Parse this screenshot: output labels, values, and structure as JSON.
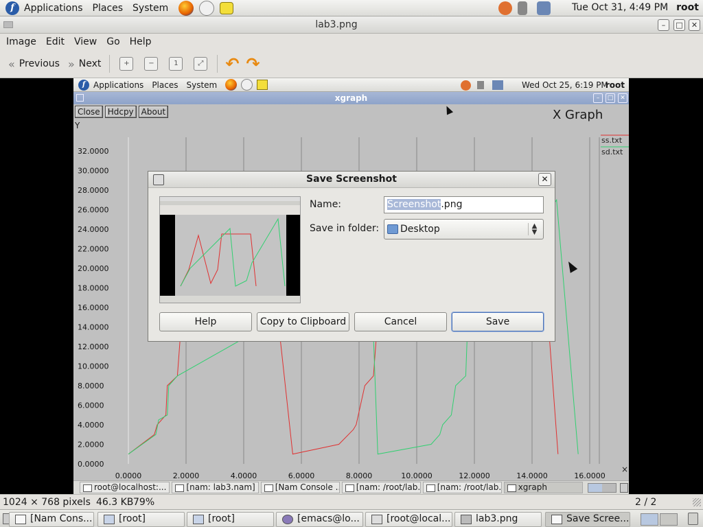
{
  "top_panel": {
    "menus": [
      "Applications",
      "Places",
      "System"
    ],
    "clock": "Tue Oct 31,  4:49 PM",
    "user": "root"
  },
  "window": {
    "title": "lab3.png",
    "menus": [
      "Image",
      "Edit",
      "View",
      "Go",
      "Help"
    ],
    "toolbar": {
      "previous": "Previous",
      "next": "Next"
    }
  },
  "inner": {
    "menus": [
      "Applications",
      "Places",
      "System"
    ],
    "clock": "Wed Oct 25,  6:19 PM",
    "user": "root",
    "xgraph": {
      "title": "xgraph",
      "buttons": [
        "Close",
        "Hdcpy",
        "About"
      ],
      "graph_title": "X Graph",
      "ylabel": "Y",
      "legend": [
        "ss.txt",
        "sd.txt"
      ]
    },
    "taskbar": [
      "root@localhost:...",
      "[nam: lab3.nam]",
      "[Nam Console ...",
      "[nam: /root/lab...",
      "[nam: /root/lab...",
      "xgraph"
    ]
  },
  "chart_data": {
    "type": "line",
    "title": "X Graph",
    "xlabel": "",
    "ylabel": "Y",
    "xlim": [
      0,
      16
    ],
    "ylim": [
      0,
      32
    ],
    "x_ticks": [
      "0.0000",
      "2.0000",
      "4.0000",
      "6.0000",
      "8.0000",
      "10.0000",
      "12.0000",
      "14.0000",
      "16.0000"
    ],
    "y_ticks": [
      "0.0000",
      "2.0000",
      "4.0000",
      "6.0000",
      "8.0000",
      "10.0000",
      "12.0000",
      "14.0000",
      "16.0000",
      "18.0000",
      "20.0000",
      "22.0000",
      "24.0000",
      "26.0000",
      "28.0000",
      "30.0000",
      "32.0000"
    ],
    "grid": true,
    "legend_position": "top-right",
    "series": [
      {
        "name": "ss.txt",
        "color": "#e03030",
        "points": [
          [
            0.0,
            1.0
          ],
          [
            0.9,
            3.0
          ],
          [
            1.0,
            4.0
          ],
          [
            1.3,
            5.0
          ],
          [
            1.35,
            8.0
          ],
          [
            1.7,
            9.0
          ],
          [
            1.8,
            13.0
          ],
          [
            5.0,
            20.0
          ],
          [
            5.7,
            1.0
          ],
          [
            7.3,
            2.0
          ],
          [
            7.8,
            3.5
          ],
          [
            7.9,
            4.0
          ],
          [
            8.2,
            8.0
          ],
          [
            8.5,
            9.0
          ],
          [
            8.6,
            13.0
          ],
          [
            14.6,
            13.0
          ],
          [
            14.9,
            1.0
          ]
        ]
      },
      {
        "name": "sd.txt",
        "color": "#30d070",
        "points": [
          [
            0.0,
            1.0
          ],
          [
            0.95,
            3.0
          ],
          [
            1.05,
            4.5
          ],
          [
            1.35,
            5.0
          ],
          [
            1.4,
            8.0
          ],
          [
            1.7,
            9.0
          ],
          [
            8.3,
            20.0
          ],
          [
            8.5,
            13.0
          ],
          [
            8.65,
            1.0
          ],
          [
            10.5,
            2.0
          ],
          [
            10.8,
            3.0
          ],
          [
            10.9,
            4.0
          ],
          [
            11.2,
            5.0
          ],
          [
            11.35,
            8.0
          ],
          [
            11.7,
            9.0
          ],
          [
            11.75,
            13.0
          ],
          [
            14.85,
            27.0
          ],
          [
            15.6,
            1.0
          ]
        ]
      }
    ]
  },
  "dialog": {
    "title": "Save Screenshot",
    "name_label": "Name:",
    "name_selected": "Screenshot",
    "name_rest": ".png",
    "folder_label": "Save in folder:",
    "folder": "Desktop",
    "buttons": {
      "help": "Help",
      "copy": "Copy to Clipboard",
      "cancel": "Cancel",
      "save": "Save"
    }
  },
  "statusbar": {
    "dimensions": "1024 × 768 pixels",
    "size": "46.3 KB",
    "zoom": "79%",
    "position": "2 / 2"
  },
  "taskbar": [
    "[Nam Cons...",
    "[root]",
    "[root]",
    "[emacs@lo...",
    "[root@local...",
    "lab3.png",
    "Save Scree..."
  ]
}
